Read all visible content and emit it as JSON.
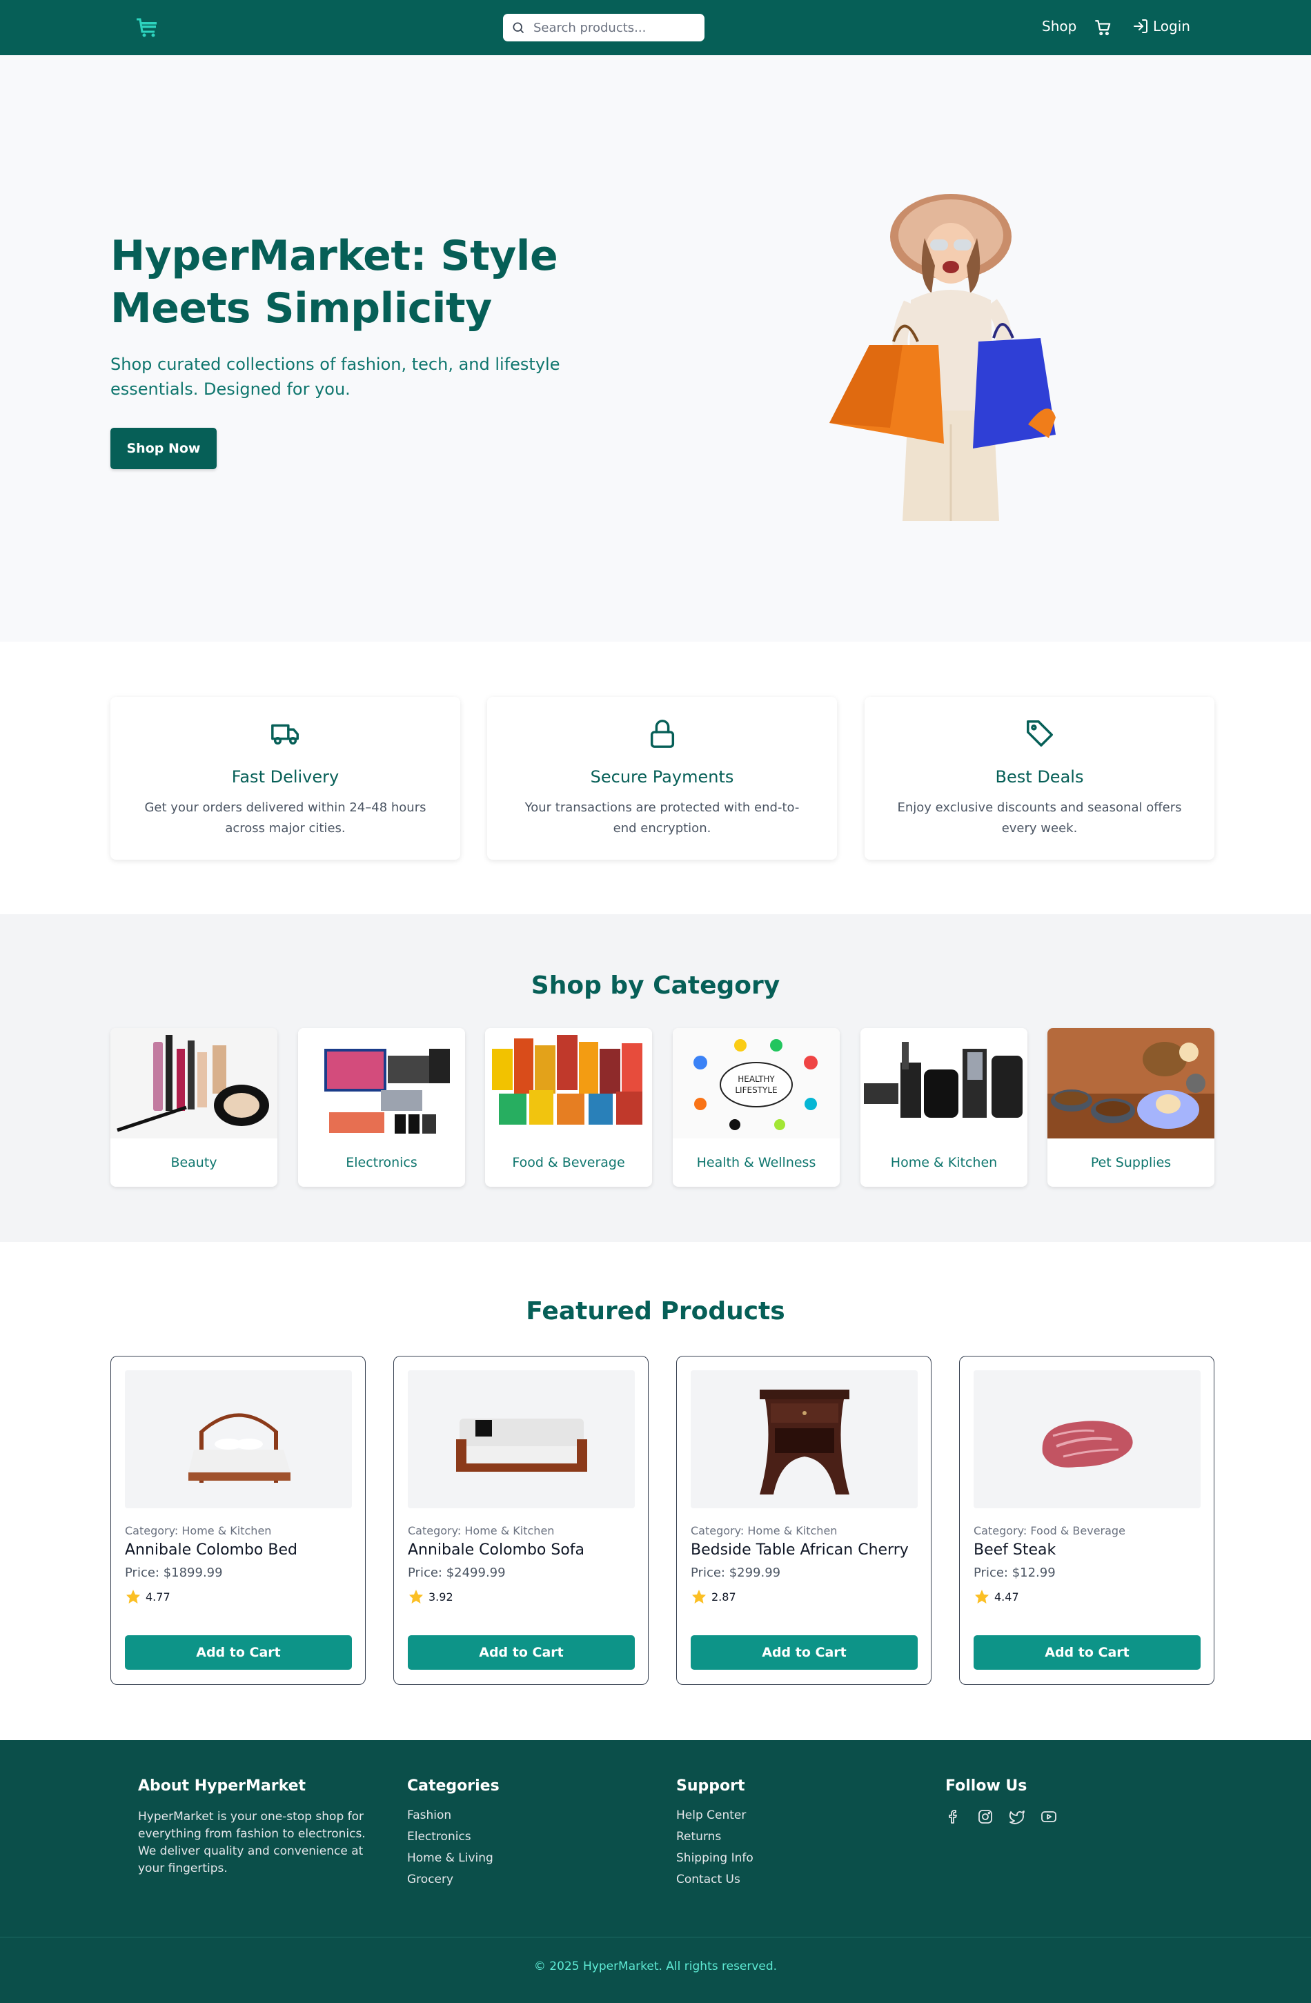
{
  "navbar": {
    "logo_icon": "cart-logo-icon",
    "search_placeholder": "Search products...",
    "shop_label": "Shop",
    "cart_icon": "cart-icon",
    "login_label": "Login",
    "colors": {
      "bg": "#065f57",
      "logo": "#2dd4bf"
    }
  },
  "hero": {
    "title": "HyperMarket: Style Meets Simplicity",
    "subtitle": "Shop curated collections of fashion, tech, and lifestyle essentials. Designed for you.",
    "button_label": "Shop Now"
  },
  "features": [
    {
      "icon": "truck-icon",
      "title": "Fast Delivery",
      "desc": "Get your orders delivered within 24–48 hours across major cities."
    },
    {
      "icon": "lock-icon",
      "title": "Secure Payments",
      "desc": "Your transactions are protected with end-to-end encryption."
    },
    {
      "icon": "tag-icon",
      "title": "Best Deals",
      "desc": "Enjoy exclusive discounts and seasonal offers every week."
    }
  ],
  "categories": {
    "title": "Shop by Category",
    "items": [
      {
        "label": "Beauty"
      },
      {
        "label": "Electronics"
      },
      {
        "label": "Food & Beverage"
      },
      {
        "label": "Health & Wellness"
      },
      {
        "label": "Home & Kitchen"
      },
      {
        "label": "Pet Supplies"
      }
    ]
  },
  "featured": {
    "title": "Featured Products",
    "button_label": "Add to Cart",
    "products": [
      {
        "category": "Category: Home & Kitchen",
        "name": "Annibale Colombo Bed",
        "price": "Price: $1899.99",
        "rating": "4.77"
      },
      {
        "category": "Category: Home & Kitchen",
        "name": "Annibale Colombo Sofa",
        "price": "Price: $2499.99",
        "rating": "3.92"
      },
      {
        "category": "Category: Home & Kitchen",
        "name": "Bedside Table African Cherry",
        "price": "Price: $299.99",
        "rating": "2.87"
      },
      {
        "category": "Category: Food & Beverage",
        "name": "Beef Steak",
        "price": "Price: $12.99",
        "rating": "4.47"
      }
    ]
  },
  "footer": {
    "about_title": "About HyperMarket",
    "about_text": "HyperMarket is your one-stop shop for everything from fashion to electronics. We deliver quality and convenience at your fingertips.",
    "categories_title": "Categories",
    "categories_links": [
      "Fashion",
      "Electronics",
      "Home & Living",
      "Grocery"
    ],
    "support_title": "Support",
    "support_links": [
      "Help Center",
      "Returns",
      "Shipping Info",
      "Contact Us"
    ],
    "follow_title": "Follow Us",
    "social_icons": [
      "facebook-icon",
      "instagram-icon",
      "twitter-icon",
      "youtube-icon"
    ],
    "copyright": "© 2025 HyperMarket. All rights reserved."
  }
}
